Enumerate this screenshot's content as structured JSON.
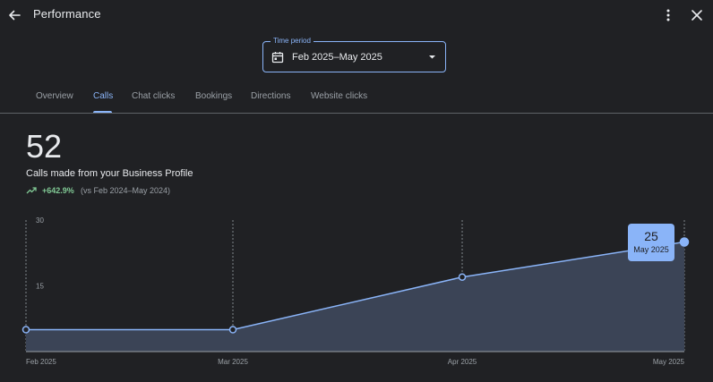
{
  "header": {
    "title": "Performance"
  },
  "time_period": {
    "legend": "Time period",
    "value": "Feb 2025–May 2025"
  },
  "tabs": [
    {
      "label": "Overview",
      "active": false
    },
    {
      "label": "Calls",
      "active": true
    },
    {
      "label": "Chat clicks",
      "active": false
    },
    {
      "label": "Bookings",
      "active": false
    },
    {
      "label": "Directions",
      "active": false
    },
    {
      "label": "Website clicks",
      "active": false
    }
  ],
  "metric": {
    "value": "52",
    "label": "Calls made from your Business Profile",
    "change": "+642.9%",
    "comparison": "(vs Feb 2024–May 2024)"
  },
  "tooltip": {
    "value": "25",
    "date": "May 2025"
  },
  "colors": {
    "accent": "#8ab4f8",
    "positive": "#81c995",
    "background": "#202124",
    "area_fill": "#3b4456"
  },
  "chart_data": {
    "type": "area",
    "x": [
      "Feb 2025",
      "Mar 2025",
      "Apr 2025",
      "May 2025"
    ],
    "series": [
      {
        "values": [
          5,
          5,
          17,
          25
        ]
      }
    ],
    "y_ticks": [
      15,
      30
    ],
    "ylim": [
      0,
      30
    ],
    "grid": "vertical dashed lines at each x label"
  }
}
